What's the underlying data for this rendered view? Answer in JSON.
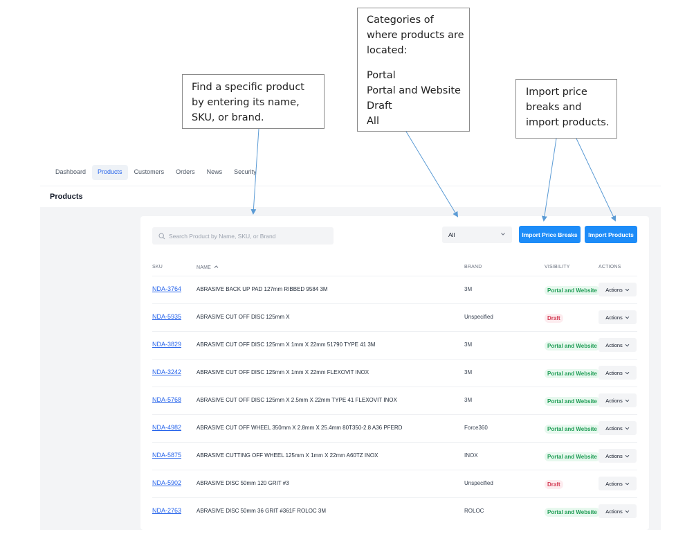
{
  "callouts": {
    "search": "Find a specific product by entering its name, SKU, or brand.",
    "categories": {
      "intro": "Categories of where products are located:",
      "items": [
        "Portal",
        "Portal and Website",
        "Draft",
        "All"
      ]
    },
    "import": "Import price breaks and import products."
  },
  "nav": {
    "items": [
      "Dashboard",
      "Products",
      "Customers",
      "Orders",
      "News",
      "Security"
    ],
    "active": "Products"
  },
  "page": {
    "title": "Products"
  },
  "toolbar": {
    "search_placeholder": "Search Product by Name, SKU, or Brand",
    "visibility_filter": "All",
    "import_price_breaks": "Import Price Breaks",
    "import_products": "Import Products"
  },
  "table": {
    "headers": {
      "sku": "SKU",
      "name": "NAME",
      "brand": "BRAND",
      "visibility": "VISIBILITY",
      "actions": "ACTIONS"
    },
    "sort_indicator": "^",
    "action_label": "Actions",
    "rows": [
      {
        "sku": "NDA-3764",
        "name": "ABRASIVE BACK UP PAD 127mm RIBBED 9584 3M",
        "brand": "3M",
        "visibility": "Portal and Website"
      },
      {
        "sku": "NDA-5935",
        "name": "ABRASIVE CUT OFF DISC 125mm X",
        "brand": "Unspecified",
        "visibility": "Draft"
      },
      {
        "sku": "NDA-3829",
        "name": "ABRASIVE CUT OFF DISC 125mm X 1mm X 22mm 51790 TYPE 41 3M",
        "brand": "3M",
        "visibility": "Portal and Website"
      },
      {
        "sku": "NDA-3242",
        "name": "ABRASIVE CUT OFF DISC 125mm X 1mm X 22mm FLEXOVIT INOX",
        "brand": "3M",
        "visibility": "Portal and Website"
      },
      {
        "sku": "NDA-5768",
        "name": "ABRASIVE CUT OFF DISC 125mm X 2.5mm X 22mm TYPE 41 FLEXOVIT INOX",
        "brand": "3M",
        "visibility": "Portal and Website"
      },
      {
        "sku": "NDA-4982",
        "name": "ABRASIVE CUT OFF WHEEL 350mm X 2.8mm X 25.4mm 80T350-2.8 A36 PFERD",
        "brand": "Force360",
        "visibility": "Portal and Website"
      },
      {
        "sku": "NDA-5875",
        "name": "ABRASIVE CUTTING OFF WHEEL 125mm X 1mm X 22mm A60TZ INOX",
        "brand": "INOX",
        "visibility": "Portal and Website"
      },
      {
        "sku": "NDA-5902",
        "name": "ABRASIVE DISC 50mm 120 GRIT #3",
        "brand": "Unspecified",
        "visibility": "Draft"
      },
      {
        "sku": "NDA-2763",
        "name": "ABRASIVE DISC 50mm 36 GRIT #361F ROLOC 3M",
        "brand": "ROLOC",
        "visibility": "Portal and Website"
      }
    ]
  },
  "colors": {
    "accent": "#1d8cf8",
    "link": "#2563eb",
    "portal_badge_bg": "#e7f8ee",
    "portal_badge_text": "#1f9d55",
    "draft_badge_bg": "#fdecef",
    "draft_badge_text": "#d23a52",
    "arrow": "#5b9bd5"
  }
}
